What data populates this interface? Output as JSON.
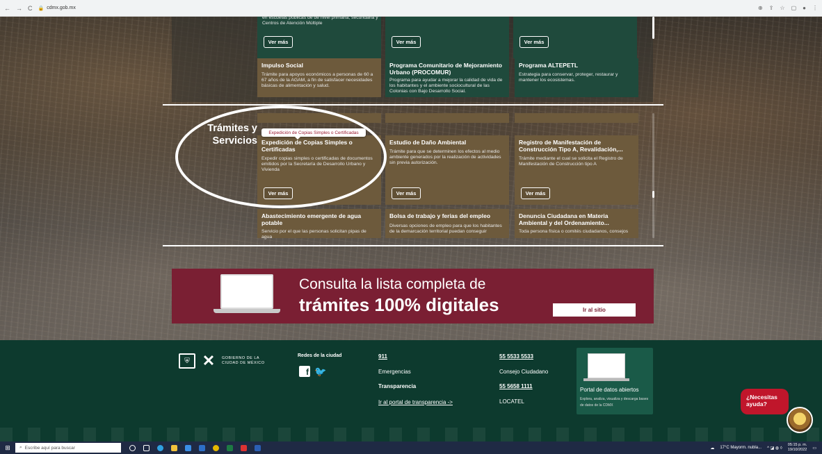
{
  "browser": {
    "url": "cdmx.gob.mx",
    "back": "←",
    "forward": "→",
    "reload": "C"
  },
  "top_cards": {
    "card1_desc": "en escuelas públicas de de nivel primaria, secundaria y Centros de Atención Múltiple",
    "ver_mas": "Ver más",
    "row2": [
      {
        "title": "Impulso Social",
        "desc": "Trámite para apoyos económicos a personas de 60 a 67 años de la AGAM, a fin de satisfacer necesidades básicas de alimentación y salud."
      },
      {
        "title": "Programa Comunitario de Mejoramiento Urbano (PROCOMUR)",
        "desc": "Programa para ayudar a mejorar la calidad de vida de los habitantes y el ambiente sociocultural de las Colonias con Bajo Desarrollo Social."
      },
      {
        "title": "Programa ALTEPETL",
        "desc": "Estrategia para conservar, proteger, restaurar y mantener los ecosistemas."
      }
    ]
  },
  "tramites": {
    "section_title_1": "Trámites y",
    "section_title_2": "Servicios",
    "tooltip": "Expedición de Copias Simples o Certificadas",
    "ver_mas": "Ver más",
    "row1": [
      {
        "title": "Expedición de Copias Simples o Certificadas",
        "desc": "Expedir copias simples o certificadas de documentos emitidos por la Secretaría de Desarrollo Urbano y Vivienda"
      },
      {
        "title": "Estudio de Daño Ambiental",
        "desc": "Trámite para que se determinen los efectos al medio ambiente generados por la realización de actividades sin previa autorización."
      },
      {
        "title": "Registro de Manifestación de Construcción Tipo A, Revalidación,...",
        "desc": "Trámite mediante el cual se solicita el Registro de Manifestación de Construcción tipo A"
      }
    ],
    "row2": [
      {
        "title": "Abastecimiento emergente de agua potable",
        "desc": "Servicio por el que las personas solicitan pipas de agua"
      },
      {
        "title": "Bolsa de trabajo y ferias del empleo",
        "desc": "Diversas opciones de empleo para que los habitantes de la demarcación territorial puedan conseguir"
      },
      {
        "title": "Denuncia Ciudadana en Materia Ambiental y del Ordenamiento...",
        "desc": "Toda persona física o comités ciudadanos, consejos"
      }
    ]
  },
  "banner": {
    "line1": "Consulta la lista completa de",
    "line2": "trámites 100% digitales",
    "button": "Ir al sitio"
  },
  "footer": {
    "gov_line1": "GOBIERNO DE LA",
    "gov_line2": "CIUDAD DE MÉXICO",
    "redes_label": "Redes de la ciudad",
    "facebook": "f",
    "twitter": "🐦",
    "phone_911": "911",
    "emergencias": "Emergencias",
    "transparencia": "Transparencia",
    "portal_transparencia": "Ir al portal de transparencia ->",
    "phone_consejo": "55 5533 5533",
    "consejo": "Consejo Ciudadano",
    "phone_locatel": "55 5658 1111",
    "locatel": "LOCATEL",
    "portal_title": "Portal de datos abiertos",
    "portal_desc": "Explora, analiza, visualiza y descarga bases de datos de la CDMX",
    "help": "¿Necesitas ayuda?"
  },
  "taskbar": {
    "search_placeholder": "Escribe aquí para buscar",
    "weather": "17°C Mayorm. nubla...",
    "time": "05:15 p. m.",
    "date": "19/10/2022"
  }
}
